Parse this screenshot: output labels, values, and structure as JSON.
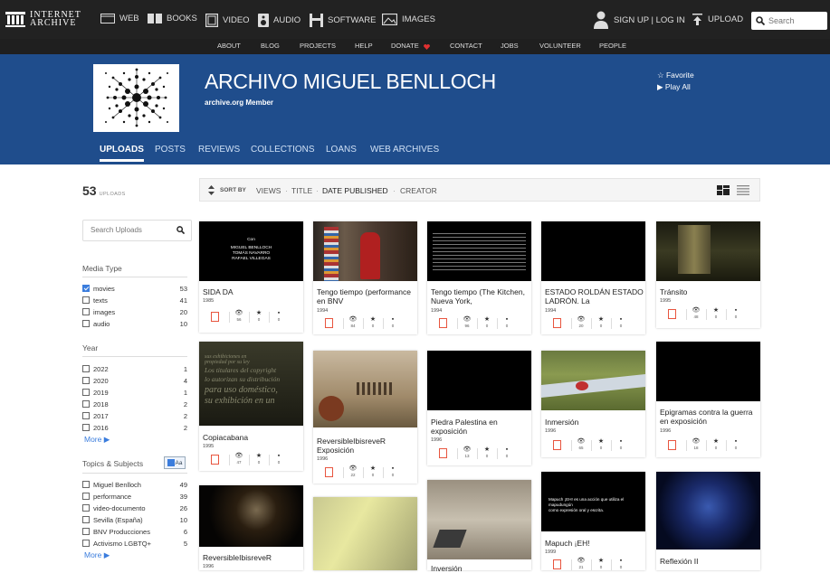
{
  "topbar": {
    "logo_line1": "INTERNET",
    "logo_line2": "ARCHIVE",
    "nav": [
      "WEB",
      "BOOKS",
      "VIDEO",
      "AUDIO",
      "SOFTWARE",
      "IMAGES"
    ],
    "signup": "SIGN UP | LOG IN",
    "upload": "UPLOAD",
    "search_placeholder": "Search"
  },
  "subnav": [
    "ABOUT",
    "BLOG",
    "PROJECTS",
    "HELP",
    "DONATE",
    "CONTACT",
    "JOBS",
    "VOLUNTEER",
    "PEOPLE"
  ],
  "banner": {
    "title": "ARCHIVO MIGUEL BENLLOCH",
    "member": "archive.org Member",
    "favorite": "☆ Favorite",
    "play_all": "▶ Play All"
  },
  "tabs": [
    "UPLOADS",
    "POSTS",
    "REVIEWS",
    "COLLECTIONS",
    "LOANS",
    "WEB ARCHIVES"
  ],
  "sidebar": {
    "count": "53",
    "count_label": "UPLOADS",
    "search_placeholder": "Search Uploads",
    "media_type_heading": "Media Type",
    "media_types": [
      {
        "label": "movies",
        "count": "53",
        "checked": true
      },
      {
        "label": "texts",
        "count": "41",
        "checked": false
      },
      {
        "label": "images",
        "count": "20",
        "checked": false
      },
      {
        "label": "audio",
        "count": "10",
        "checked": false
      }
    ],
    "year_heading": "Year",
    "years": [
      {
        "label": "2022",
        "count": "1"
      },
      {
        "label": "2020",
        "count": "4"
      },
      {
        "label": "2019",
        "count": "1"
      },
      {
        "label": "2018",
        "count": "2"
      },
      {
        "label": "2017",
        "count": "2"
      },
      {
        "label": "2016",
        "count": "2"
      }
    ],
    "more": "More ▶",
    "topics_heading": "Topics & Subjects",
    "topics": [
      {
        "label": "Miguel Benlloch",
        "count": "49"
      },
      {
        "label": "performance",
        "count": "39"
      },
      {
        "label": "video-documento",
        "count": "26"
      },
      {
        "label": "Sevilla (España)",
        "count": "10"
      },
      {
        "label": "BNV Producciones",
        "count": "6"
      },
      {
        "label": "Activismo LGBTQ+",
        "count": "5"
      }
    ]
  },
  "sortbar": {
    "sort_by": "SORT BY",
    "views": "VIEWS",
    "title": "TITLE",
    "date_published": "DATE PUBLISHED",
    "creator": "CREATOR"
  },
  "cards": [
    {
      "title": "SIDA DA",
      "year": "1985",
      "views": "56",
      "favs": "0",
      "reviews": "0",
      "thumb_lines": [
        "Con",
        "MIGUEL BENLLOCH",
        "TOMÁS NAVARRO",
        "RAFAEL VILLEGAS"
      ]
    },
    {
      "title": "Tengo tiempo (performance en BNV",
      "year": "1994",
      "views": "84",
      "favs": "0",
      "reviews": "0"
    },
    {
      "title": "Tengo tiempo (The Kitchen, Nueva York,",
      "year": "1994",
      "views": "96",
      "favs": "0",
      "reviews": "0"
    },
    {
      "title": "ESTADO ROLDÁN ESTADO LADRÓN. La",
      "year": "1994",
      "views": "20",
      "favs": "0",
      "reviews": "0"
    },
    {
      "title": "Tránsito",
      "year": "1995",
      "views": "48",
      "favs": "0",
      "reviews": "0"
    },
    {
      "title": "Copiacabana",
      "year": "1995",
      "views": "47",
      "favs": "0",
      "reviews": "0",
      "thumb_lines": [
        "sus exhibiciones en",
        "propiedad por su ley",
        "Los titulares del copyright",
        "lo autorizan su distribución",
        "para uso doméstico,",
        "su exhibición en un"
      ]
    },
    {
      "title": "ReversibleIbisreveR Exposición",
      "year": "1996",
      "views": "22",
      "favs": "0",
      "reviews": "0"
    },
    {
      "title": "Piedra Palestina en exposición",
      "year": "1996",
      "views": "13",
      "favs": "0",
      "reviews": "0"
    },
    {
      "title": "Inmersión",
      "year": "1996",
      "views": "65",
      "favs": "0",
      "reviews": "0"
    },
    {
      "title": "Epigramas contra la guerra en exposición",
      "year": "1996",
      "views": "18",
      "favs": "0",
      "reviews": "0"
    },
    {
      "title": "ReversibleIbisreveR",
      "year": "1996"
    },
    {
      "title": "Inversión"
    },
    {
      "title": "Mapuch ¡EH!",
      "year": "1999",
      "views": "21",
      "favs": "0",
      "reviews": "0",
      "thumb_lines": [
        "Mapuch ¡EH! es una acción que utiliza el mapudungún",
        "como expresión oral y escrita."
      ]
    },
    {
      "title": "Reflexión II",
      "year": "1999"
    }
  ]
}
